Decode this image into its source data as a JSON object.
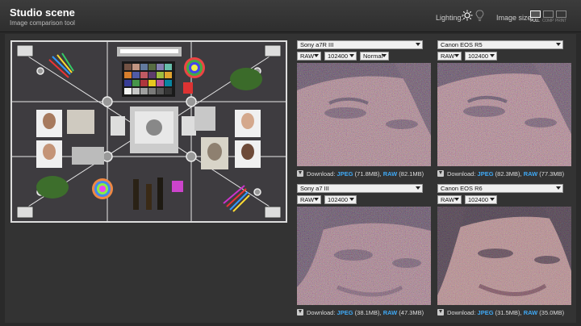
{
  "header": {
    "title": "Studio scene",
    "subtitle": "Image comparison tool",
    "lighting_label": "Lighting:",
    "image_size_label": "Image size:",
    "size_options": [
      "FULL",
      "COMP",
      "PRINT"
    ]
  },
  "panels": [
    {
      "camera": "Sony a7R III",
      "format": "RAW",
      "iso": "102400",
      "mode": "Normal",
      "download_label": "Download:",
      "jpeg_label": "JPEG",
      "jpeg_size": "(71.8MB),",
      "raw_label": "RAW",
      "raw_size": "(82.1MB)"
    },
    {
      "camera": "Canon EOS R5",
      "format": "RAW",
      "iso": "102400",
      "download_label": "Download:",
      "jpeg_label": "JPEG",
      "jpeg_size": "(82.3MB),",
      "raw_label": "RAW",
      "raw_size": "(77.3MB)"
    },
    {
      "camera": "Sony a7 III",
      "format": "RAW",
      "iso": "102400",
      "download_label": "Download:",
      "jpeg_label": "JPEG",
      "jpeg_size": "(38.1MB),",
      "raw_label": "RAW",
      "raw_size": "(47.3MB)"
    },
    {
      "camera": "Canon EOS R6",
      "format": "RAW",
      "iso": "102400",
      "download_label": "Download:",
      "jpeg_label": "JPEG",
      "jpeg_size": "(31.5MB),",
      "raw_label": "RAW",
      "raw_size": "(35.0MB)"
    }
  ],
  "colors": {
    "link": "#3fa9f5",
    "background": "#2a2a2a"
  }
}
